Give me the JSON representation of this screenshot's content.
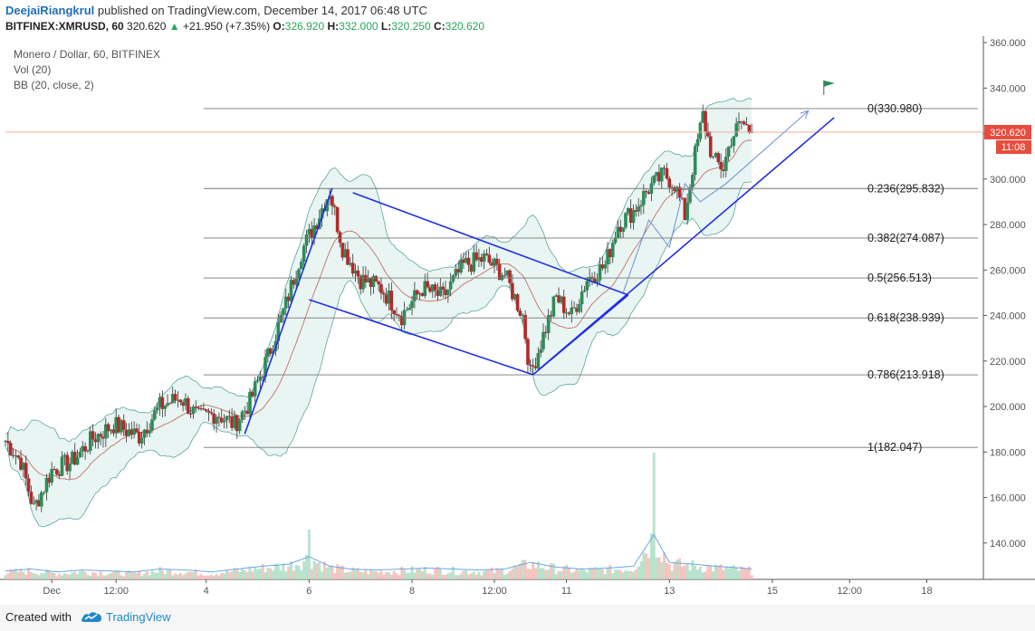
{
  "header": {
    "author": "DeejaiRiangkrul",
    "published_text": "published on TradingView.com, December 14, 2017 06:48 UTC",
    "symbol": "BITFINEX:XMRUSD, 60",
    "last": "320.620",
    "change": "+21.950 (+7.35%)",
    "o_label": "O:",
    "o_value": "326.920",
    "h_label": "H:",
    "h_value": "332.000",
    "l_label": "L:",
    "l_value": "320.250",
    "c_label": "C:",
    "c_value": "320.620"
  },
  "legend": {
    "title": "Monero / Dollar, 60, BITFINEX",
    "vol": "Vol (20)",
    "bb": "BB (20, close, 2)"
  },
  "price_badge": {
    "value": "320.620",
    "countdown": "11:08"
  },
  "footer": {
    "created": "Created with",
    "brand": "TradingView"
  },
  "chart_data": {
    "type": "candlestick",
    "symbol": "XMRUSD",
    "ylim": [
      124,
      362
    ],
    "y_ticks": [
      140,
      160,
      180,
      200,
      220,
      240,
      260,
      280,
      300,
      320,
      340,
      360
    ],
    "y_tick_labels": [
      "140.000",
      "160.000",
      "180.000",
      "200.000",
      "220.000",
      "240.000",
      "260.000",
      "280.000",
      "300.000",
      "320.000",
      "340.000",
      "360.000"
    ],
    "x_ticks": [
      {
        "label": "Dec",
        "t": 0.9
      },
      {
        "label": "12:00",
        "t": 2.15
      },
      {
        "label": "4",
        "t": 3.9
      },
      {
        "label": "6",
        "t": 5.9
      },
      {
        "label": "8",
        "t": 7.9
      },
      {
        "label": "12:00",
        "t": 9.5
      },
      {
        "label": "11",
        "t": 10.9
      },
      {
        "label": "13",
        "t": 12.9
      },
      {
        "label": "15",
        "t": 14.9
      },
      {
        "label": "12:00",
        "t": 16.4
      },
      {
        "label": "18",
        "t": 17.9
      }
    ],
    "t_range": [
      0,
      19
    ],
    "last_price": 320.62,
    "fib_levels": [
      {
        "label": "0(330.980)",
        "value": 330.98
      },
      {
        "label": "0.236(295.832)",
        "value": 295.832
      },
      {
        "label": "0.382(274.087)",
        "value": 274.087
      },
      {
        "label": "0.5(256.513)",
        "value": 256.513
      },
      {
        "label": "0.618(238.939)",
        "value": 238.939
      },
      {
        "label": "0.786(213.918)",
        "value": 213.918
      },
      {
        "label": "1(182.047)",
        "value": 182.047
      }
    ],
    "fib_t_start": 3.85,
    "price_path": [
      [
        0,
        185
      ],
      [
        0.3,
        176
      ],
      [
        0.55,
        155
      ],
      [
        0.9,
        172
      ],
      [
        1.3,
        176
      ],
      [
        1.7,
        186
      ],
      [
        2.1,
        192
      ],
      [
        2.6,
        187
      ],
      [
        3.0,
        200
      ],
      [
        3.4,
        204
      ],
      [
        3.75,
        195
      ],
      [
        4.1,
        197
      ],
      [
        4.45,
        192
      ],
      [
        4.75,
        202
      ],
      [
        5.1,
        222
      ],
      [
        5.45,
        245
      ],
      [
        5.75,
        268
      ],
      [
        6.05,
        282
      ],
      [
        6.3,
        295
      ],
      [
        6.55,
        270
      ],
      [
        6.9,
        256
      ],
      [
        7.3,
        252
      ],
      [
        7.7,
        240
      ],
      [
        8.1,
        252
      ],
      [
        8.5,
        248
      ],
      [
        8.9,
        262
      ],
      [
        9.3,
        265
      ],
      [
        9.7,
        258
      ],
      [
        10.05,
        240
      ],
      [
        10.2,
        214
      ],
      [
        10.4,
        228
      ],
      [
        10.7,
        248
      ],
      [
        11.0,
        240
      ],
      [
        11.3,
        256
      ],
      [
        11.65,
        262
      ],
      [
        11.9,
        280
      ],
      [
        12.2,
        286
      ],
      [
        12.5,
        296
      ],
      [
        12.8,
        302
      ],
      [
        13.0,
        298
      ],
      [
        13.2,
        284
      ],
      [
        13.35,
        305
      ],
      [
        13.55,
        328
      ],
      [
        13.75,
        308
      ],
      [
        13.95,
        305
      ],
      [
        14.1,
        318
      ],
      [
        14.3,
        325
      ],
      [
        14.5,
        320.62
      ]
    ],
    "volume": [
      [
        0,
        7
      ],
      [
        0.5,
        9
      ],
      [
        1.0,
        6
      ],
      [
        1.5,
        8
      ],
      [
        2.0,
        7
      ],
      [
        2.5,
        6
      ],
      [
        3.0,
        9
      ],
      [
        3.5,
        8
      ],
      [
        4.0,
        6
      ],
      [
        4.5,
        9
      ],
      [
        5.0,
        12
      ],
      [
        5.5,
        14
      ],
      [
        5.9,
        22
      ],
      [
        6.3,
        12
      ],
      [
        6.7,
        9
      ],
      [
        7.2,
        8
      ],
      [
        7.7,
        9
      ],
      [
        8.2,
        10
      ],
      [
        8.7,
        9
      ],
      [
        9.2,
        8
      ],
      [
        9.7,
        9
      ],
      [
        10.2,
        16
      ],
      [
        10.7,
        11
      ],
      [
        11.2,
        9
      ],
      [
        11.7,
        10
      ],
      [
        12.2,
        12
      ],
      [
        12.6,
        45
      ],
      [
        12.9,
        16
      ],
      [
        13.4,
        14
      ],
      [
        13.8,
        12
      ],
      [
        14.3,
        10
      ],
      [
        14.5,
        9
      ]
    ],
    "channel_lines": [
      [
        [
          4.65,
          188
        ],
        [
          6.35,
          296
        ]
      ],
      [
        [
          6.75,
          294
        ],
        [
          12.1,
          249
        ]
      ],
      [
        [
          5.9,
          247
        ],
        [
          10.25,
          214
        ]
      ],
      [
        [
          10.25,
          214
        ],
        [
          12.1,
          249
        ]
      ],
      [
        [
          10.35,
          216
        ],
        [
          16.1,
          327
        ]
      ]
    ],
    "arrow_path": [
      [
        12.0,
        250
      ],
      [
        12.5,
        282
      ],
      [
        12.9,
        270
      ],
      [
        13.2,
        298
      ],
      [
        13.5,
        290
      ],
      [
        14.0,
        298
      ],
      [
        15.6,
        330
      ]
    ],
    "flag": {
      "t": 15.9,
      "price": 337
    }
  }
}
